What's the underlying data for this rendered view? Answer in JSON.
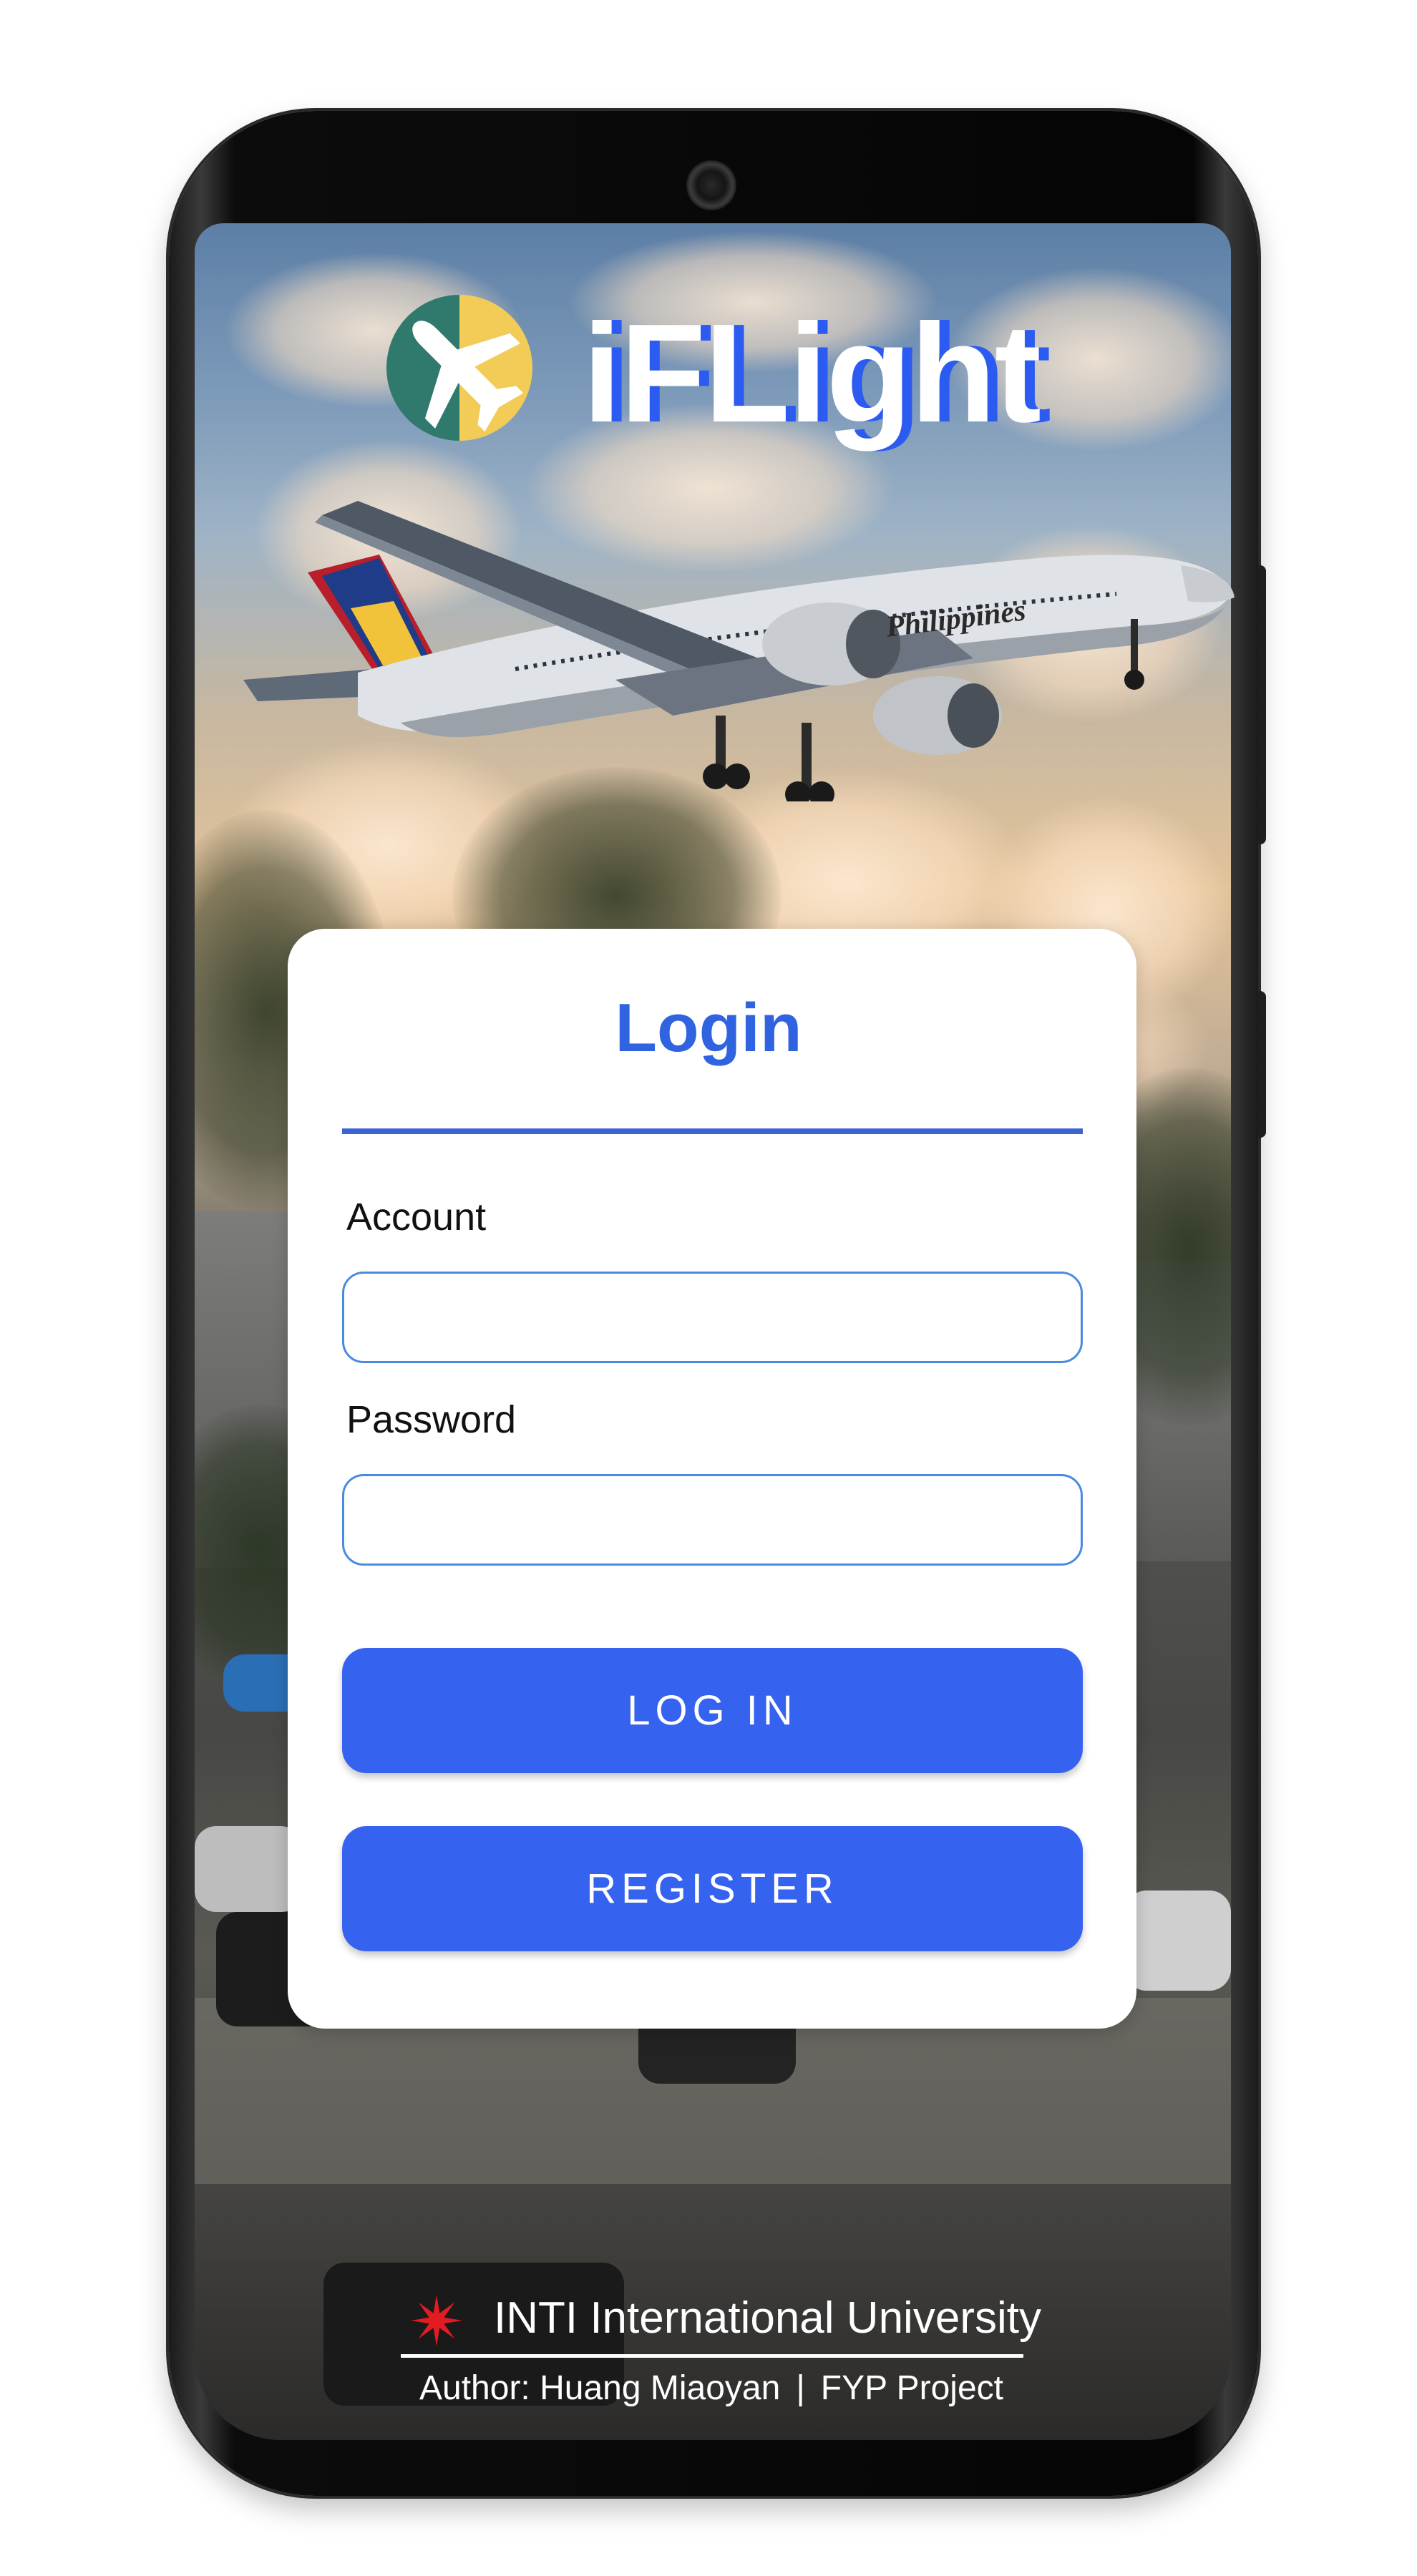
{
  "app": {
    "brand_name": "iFLight",
    "logo_icon": "airplane-icon"
  },
  "login": {
    "title": "Login",
    "account_label": "Account",
    "account_value": "",
    "password_label": "Password",
    "password_value": "",
    "login_button": "LOG IN",
    "register_button": "REGISTER"
  },
  "background": {
    "aircraft_livery_text": "Philippines"
  },
  "footer": {
    "university": "INTI International University",
    "author": "Author: Huang Miaoyan",
    "separator": "|",
    "project": "FYP Project"
  },
  "colors": {
    "accent": "#3662f0",
    "title_blue": "#2f63e0",
    "input_border": "#4a8be0",
    "logo_green": "#2f7a6c",
    "logo_yellow": "#f3cc58"
  }
}
